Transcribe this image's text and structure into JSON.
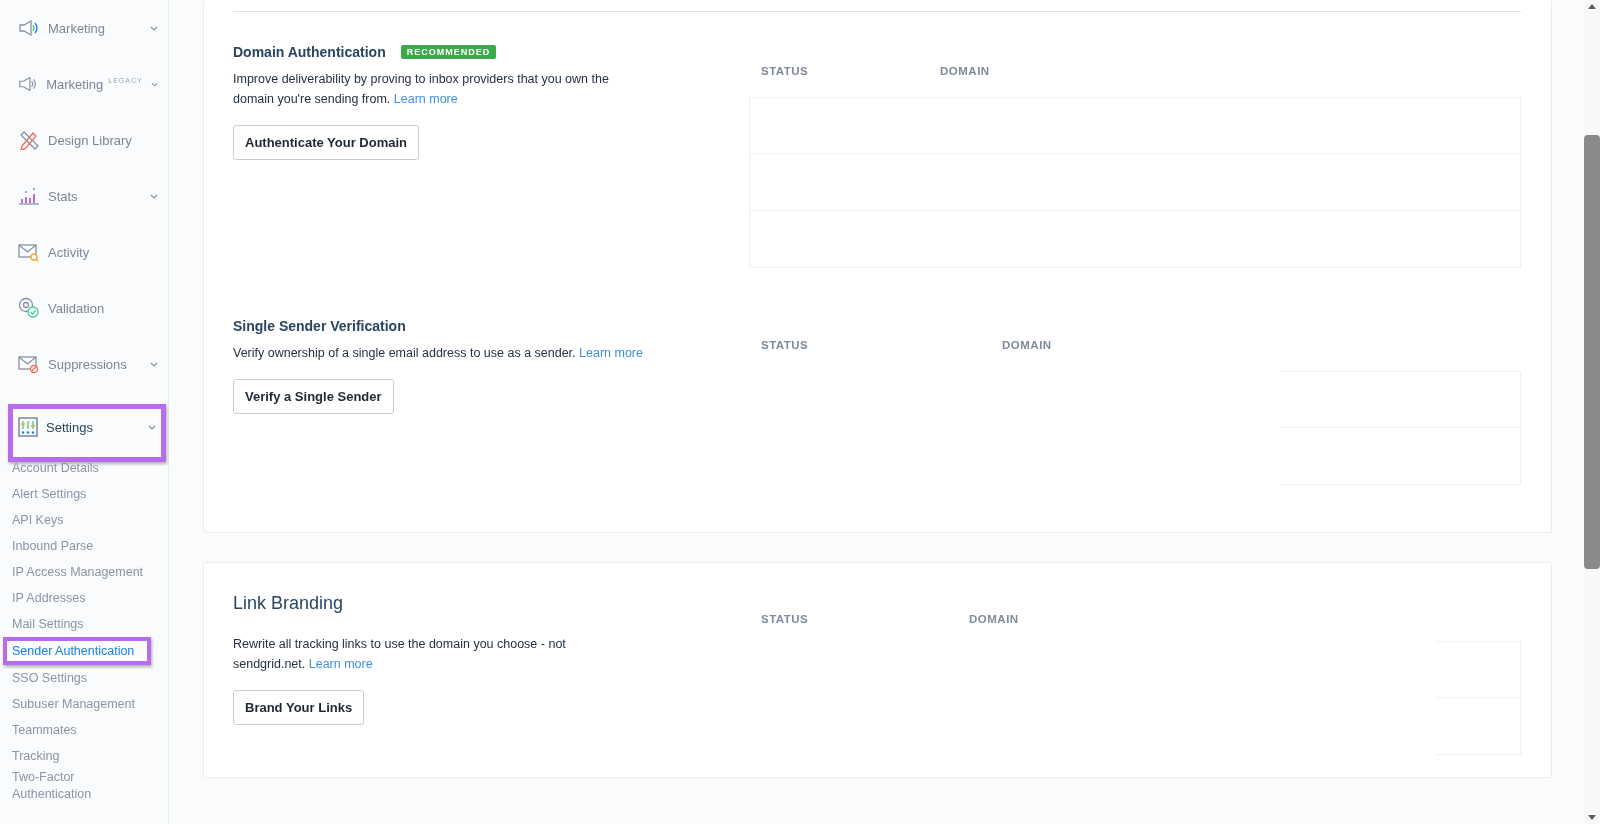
{
  "sidebar": {
    "items": [
      {
        "label": "Marketing",
        "has_caret": true,
        "highlighted": false
      },
      {
        "label": "Marketing",
        "tag": "LEGACY",
        "has_caret": true,
        "highlighted": false
      },
      {
        "label": "Design Library",
        "has_caret": false,
        "highlighted": false
      },
      {
        "label": "Stats",
        "has_caret": true,
        "highlighted": false
      },
      {
        "label": "Activity",
        "has_caret": false,
        "highlighted": false
      },
      {
        "label": "Validation",
        "has_caret": false,
        "highlighted": false
      },
      {
        "label": "Suppressions",
        "has_caret": true,
        "highlighted": false
      },
      {
        "label": "Settings",
        "has_caret": true,
        "highlighted": true,
        "expanded": true,
        "children": [
          {
            "label": "Account Details",
            "selected": false,
            "highlighted": false
          },
          {
            "label": "Alert Settings",
            "selected": false,
            "highlighted": false
          },
          {
            "label": "API Keys",
            "selected": false,
            "highlighted": false
          },
          {
            "label": "Inbound Parse",
            "selected": false,
            "highlighted": false
          },
          {
            "label": "IP Access Management",
            "selected": false,
            "highlighted": false
          },
          {
            "label": "IP Addresses",
            "selected": false,
            "highlighted": false
          },
          {
            "label": "Mail Settings",
            "selected": false,
            "highlighted": false
          },
          {
            "label": "Sender Authentication",
            "selected": true,
            "highlighted": true
          },
          {
            "label": "SSO Settings",
            "selected": false,
            "highlighted": false
          },
          {
            "label": "Subuser Management",
            "selected": false,
            "highlighted": false
          },
          {
            "label": "Teammates",
            "selected": false,
            "highlighted": false
          },
          {
            "label": "Tracking",
            "selected": false,
            "highlighted": false
          },
          {
            "label": "Two-Factor Authentication",
            "selected": false,
            "highlighted": false
          }
        ]
      }
    ]
  },
  "cards": [
    {
      "sections": [
        {
          "title": "Domain Authentication",
          "large": false,
          "badge": "RECOMMENDED",
          "description": "Improve deliverability by proving to inbox providers that you own the domain you're sending from.",
          "link": "Learn more",
          "button": "Authenticate Your Domain",
          "columns": [
            "STATUS",
            "DOMAIN"
          ],
          "rows": [
            {
              "kind": "full"
            },
            {
              "kind": "full"
            },
            {
              "kind": "full"
            }
          ]
        },
        {
          "title": "Single Sender Verification",
          "large": false,
          "description": "Verify ownership of a single email address to use as a sender.",
          "link": "Learn more",
          "button": "Verify a Single Sender",
          "columns": [
            "STATUS",
            "DOMAIN"
          ],
          "rows": [
            {
              "kind": "edge"
            },
            {
              "kind": "edge"
            }
          ]
        }
      ]
    },
    {
      "sections": [
        {
          "title": "Link Branding",
          "large": true,
          "description": "Rewrite all tracking links to use the domain you choose - not sendgrid.net.",
          "link": "Learn more",
          "button": "Brand Your Links",
          "columns": [
            "STATUS",
            "DOMAIN"
          ],
          "rows": [
            {
              "kind": "edge"
            },
            {
              "kind": "edge"
            }
          ]
        }
      ]
    }
  ]
}
